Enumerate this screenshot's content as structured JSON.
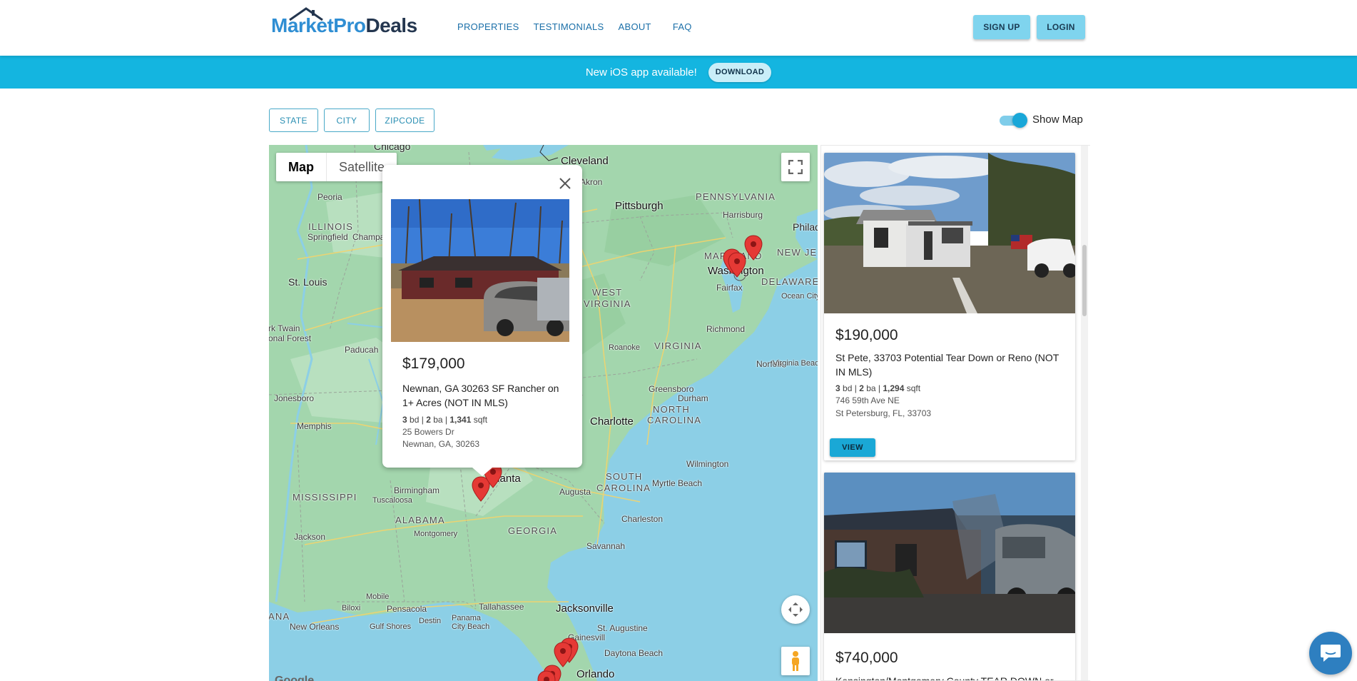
{
  "header": {
    "logo_part1": "MarketPro",
    "logo_part2": "Deals",
    "nav": [
      "PROPERTIES",
      "TESTIMONIALS",
      "ABOUT",
      "FAQ"
    ],
    "signup_label": "SIGN UP",
    "login_label": "LOGIN"
  },
  "banner": {
    "text": "New iOS app available!",
    "download_label": "DOWNLOAD"
  },
  "filters": {
    "state": "STATE",
    "city": "CITY",
    "zipcode": "ZIPCODE"
  },
  "show_map": {
    "label": "Show Map",
    "on": true
  },
  "map": {
    "type_map": "Map",
    "type_satellite": "Satellite",
    "google": "Google",
    "labels": {
      "chicago": "Chicago",
      "cleveland": "Cleveland",
      "akron": "Akron",
      "pennsylvania": "PENNSYLVANIA",
      "pittsburgh": "Pittsburgh",
      "harrisburg": "Harrisburg",
      "philadelphia": "Philadelph",
      "new_jersey": "NEW JE",
      "peoria": "Peoria",
      "illinois": "ILLINOIS",
      "springfield": "Springfield",
      "champaign": "Champa",
      "maryland": "MARYLAND",
      "washington": "Washington",
      "delaware": "DELAWARE",
      "fairfax": "Fairfax",
      "ocean_city": "Ocean City",
      "st_louis": "St. Louis",
      "west_virginia_1": "WEST",
      "west_virginia_2": "VIRGINIA",
      "mark_twain_1": "rk Twain",
      "mark_twain_2": "onal Forest",
      "paducah": "Paducah",
      "richmond": "Richmond",
      "roanoke": "Roanoke",
      "virginia": "VIRGINIA",
      "norfolk": "Norfolk",
      "virginia_beach": "Virginia Beac",
      "jonesboro": "Jonesboro",
      "greensboro": "Greensboro",
      "durham": "Durham",
      "memphis": "Memphis",
      "north_carolina_1": "NORTH",
      "north_carolina_2": "CAROLINA",
      "charlotte": "Charlotte",
      "wilmington": "Wilmington",
      "atlanta": "Atlanta",
      "south_carolina_1": "SOUTH",
      "south_carolina_2": "CAROLINA",
      "myrtle_beach": "Myrtle Beach",
      "mississippi": "MISSISSIPPI",
      "birmingham": "Birmingham",
      "tuscaloosa": "Tuscaloosa",
      "augusta": "Augusta",
      "alabama": "ALABAMA",
      "charleston": "Charleston",
      "jackson": "Jackson",
      "montgomery": "Montgomery",
      "georgia": "GEORGIA",
      "savannah": "Savannah",
      "mobile": "Mobile",
      "jacksonville": "Jacksonville",
      "tallahassee": "Tallahassee",
      "biloxi": "Biloxi",
      "pensacola": "Pensacola",
      "louisiana_frag": "ANA",
      "destin": "Destin",
      "panama_city_1": "Panama",
      "panama_city_2": "City Beach",
      "st_augustine": "St. Augustine",
      "new_orleans": "New Orleans",
      "gulf_shores": "Gulf Shores",
      "gainesville": "Gainesvill",
      "daytona_beach": "Daytona Beach",
      "orlando": "Orlando"
    }
  },
  "infowindow": {
    "price": "$179,000",
    "title": "Newnan, GA 30263 SF Rancher on 1+ Acres (NOT IN MLS)",
    "beds": "3",
    "baths": "2",
    "sqft": "1,341",
    "bd_label": "bd",
    "ba_label": "ba",
    "sqft_label": "sqft",
    "address_line1": "25 Bowers Dr",
    "address_line2": "Newnan, GA, 30263"
  },
  "listings": [
    {
      "price": "$190,000",
      "title": "St Pete, 33703 Potential Tear Down or Reno (NOT IN MLS)",
      "beds": "3",
      "baths": "2",
      "sqft": "1,294",
      "address_line1": "746 59th Ave NE",
      "address_line2": "St Petersburg, FL, 33703",
      "view_label": "VIEW"
    },
    {
      "price": "$740,000",
      "title": "Kensington/Montgomery County TEAR DOWN or"
    }
  ],
  "colors": {
    "brand_blue": "#2f8ed3",
    "brand_navy": "#24364f",
    "banner": "#14b5e0",
    "accent_button": "#7fd4ee",
    "pin_red": "#e53935"
  }
}
